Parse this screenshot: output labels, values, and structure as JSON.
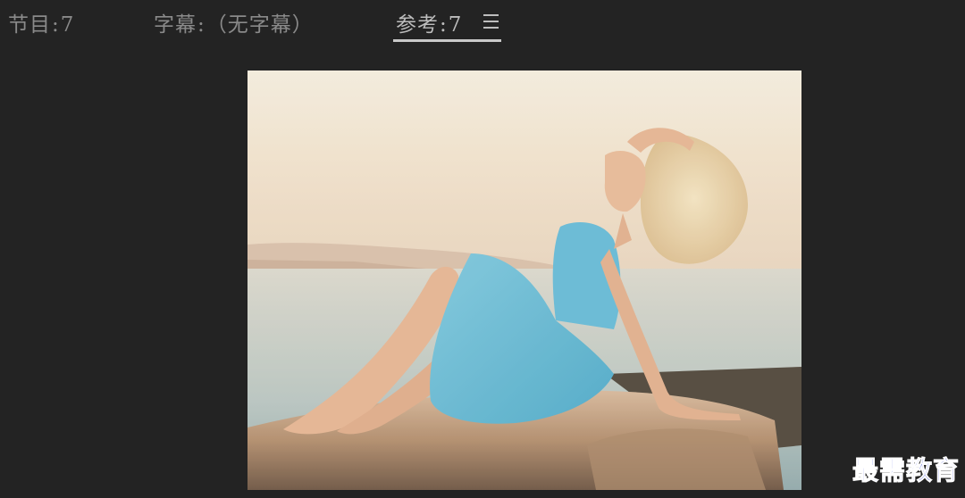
{
  "tabs": {
    "program": {
      "label": "节目",
      "sep": ":",
      "value": "7"
    },
    "caption": {
      "label": "字幕",
      "sep": ":",
      "value": "（无字幕）"
    },
    "reference": {
      "label": "参考",
      "sep": ":",
      "value": "7",
      "active": true
    }
  },
  "panel_menu_icon": "hamburger-menu-icon",
  "preview": {
    "subject": "reference-monitor-frame"
  },
  "watermark": {
    "text": "最需教育"
  },
  "colors": {
    "background": "#232323",
    "tab_inactive": "#8a8a8a",
    "tab_active": "#bdbdbd",
    "watermark": "#1a2cd6"
  }
}
